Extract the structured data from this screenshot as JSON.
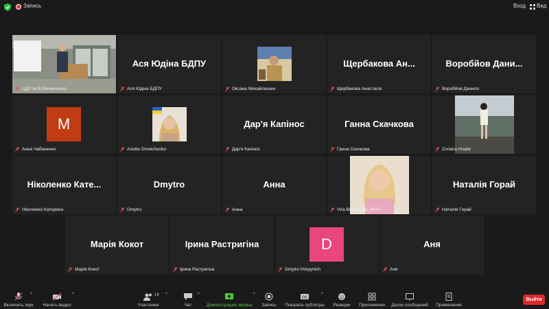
{
  "topbar": {
    "rec_label": "Запись",
    "enter_label": "Вход",
    "view_label": "Вид"
  },
  "tiles": [
    {
      "name": "",
      "label": "ЦДУ ім.В.Винниченка"
    },
    {
      "name": "Ася Юдіна БДПУ",
      "label": "Ася Юдіна БДПУ"
    },
    {
      "name": "",
      "label": "Оксана Михайлишин"
    },
    {
      "name": "Щербакова  Ан...",
      "label": "Щербакова Анастасія"
    },
    {
      "name": "Воробйов  Дани...",
      "label": "Воробйов Данило"
    },
    {
      "name": "",
      "label": "Анна Чабаненко",
      "initial": "M"
    },
    {
      "name": "",
      "label": "Anetta Omelchenko"
    },
    {
      "name": "Дар'я Капінос",
      "label": "Дар'я Капінос"
    },
    {
      "name": "Ганна Скачкова",
      "label": "Ганна Скачкова"
    },
    {
      "name": "",
      "label": "Zoriana Hnativ"
    },
    {
      "name": "Ніколенко  Кате...",
      "label": "Ніколенко Катерина"
    },
    {
      "name": "Dmytro",
      "label": "Dmytro"
    },
    {
      "name": "Анна",
      "label": "Анна"
    },
    {
      "name": "",
      "label": "Vira Burnazova_BSPU"
    },
    {
      "name": "Наталія Горай",
      "label": "Наталія Горай"
    },
    {
      "name": "Марія Кокот",
      "label": "Марія Кокот"
    },
    {
      "name": "Ірина Растригіна",
      "label": "Ірина Растригіна"
    },
    {
      "name": "",
      "label": "Dmytro Horpynich",
      "initial": "D"
    },
    {
      "name": "Аня",
      "label": "Аня"
    }
  ],
  "toolbar": {
    "audio": "Включить звук",
    "video": "Начать видео",
    "participants": "Участники",
    "participants_count": "19",
    "chat": "Чат",
    "share": "Демонстрация экрана",
    "record": "Запись",
    "subtitles": "Показать субтитры",
    "reactions": "Реакции",
    "apps": "Приложения",
    "whiteboards": "Доски сообщений",
    "notes": "Примечания",
    "leave": "Выйти"
  },
  "colors": {
    "active_speaker": "#c9e34a",
    "share_green": "#4ccb3a",
    "leave_red": "#d92a2a",
    "avatar_m": "#c23b14",
    "avatar_d": "#e8467c"
  }
}
